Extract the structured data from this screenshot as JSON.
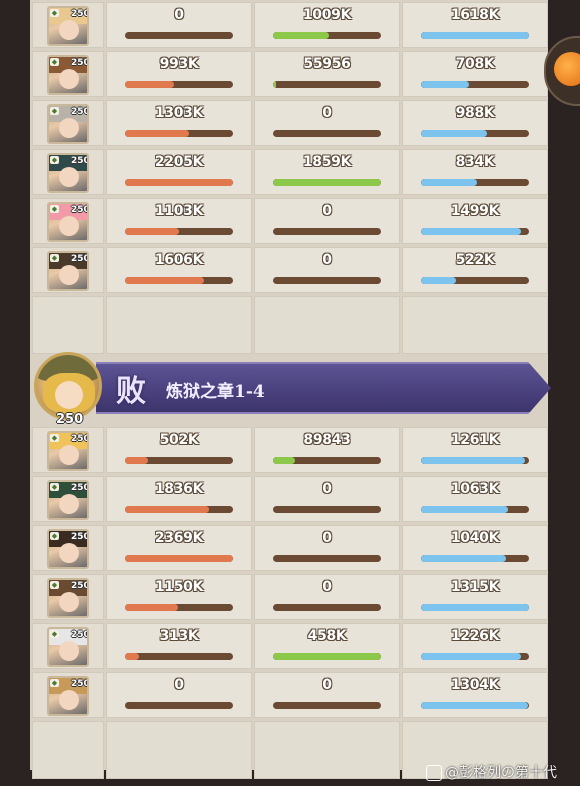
{
  "colors": {
    "damage": "#e07a4e",
    "heal": "#8cc84a",
    "tank": "#7cc4ee",
    "banner": "#4a417e"
  },
  "top_rows": [
    {
      "level": "250",
      "damage": "0",
      "damage_pct": 0,
      "heal": "1009K",
      "heal_pct": 52,
      "taken": "1618K",
      "taken_pct": 100
    },
    {
      "level": "250",
      "damage": "993K",
      "damage_pct": 45,
      "heal": "55956",
      "heal_pct": 3,
      "taken": "708K",
      "taken_pct": 44
    },
    {
      "level": "250",
      "damage": "1303K",
      "damage_pct": 59,
      "heal": "0",
      "heal_pct": 0,
      "taken": "988K",
      "taken_pct": 61
    },
    {
      "level": "250",
      "damage": "2205K",
      "damage_pct": 100,
      "heal": "1859K",
      "heal_pct": 100,
      "taken": "834K",
      "taken_pct": 52
    },
    {
      "level": "250",
      "damage": "1103K",
      "damage_pct": 50,
      "heal": "0",
      "heal_pct": 0,
      "taken": "1499K",
      "taken_pct": 93
    },
    {
      "level": "250",
      "damage": "1606K",
      "damage_pct": 73,
      "heal": "0",
      "heal_pct": 0,
      "taken": "522K",
      "taken_pct": 32
    }
  ],
  "battle": {
    "result": "败",
    "stage": "炼狱之章1-4",
    "commander_level": "250"
  },
  "bottom_rows": [
    {
      "level": "250",
      "damage": "502K",
      "damage_pct": 21,
      "heal": "89843",
      "heal_pct": 20,
      "taken": "1261K",
      "taken_pct": 96
    },
    {
      "level": "250",
      "damage": "1836K",
      "damage_pct": 78,
      "heal": "0",
      "heal_pct": 0,
      "taken": "1063K",
      "taken_pct": 81
    },
    {
      "level": "250",
      "damage": "2369K",
      "damage_pct": 100,
      "heal": "0",
      "heal_pct": 0,
      "taken": "1040K",
      "taken_pct": 79
    },
    {
      "level": "250",
      "damage": "1150K",
      "damage_pct": 49,
      "heal": "0",
      "heal_pct": 0,
      "taken": "1315K",
      "taken_pct": 100
    },
    {
      "level": "250",
      "damage": "313K",
      "damage_pct": 13,
      "heal": "458K",
      "heal_pct": 100,
      "taken": "1226K",
      "taken_pct": 93
    },
    {
      "level": "250",
      "damage": "0",
      "damage_pct": 0,
      "heal": "0",
      "heal_pct": 0,
      "taken": "1304K",
      "taken_pct": 99
    }
  ],
  "watermark": "@彭格列の第十代"
}
